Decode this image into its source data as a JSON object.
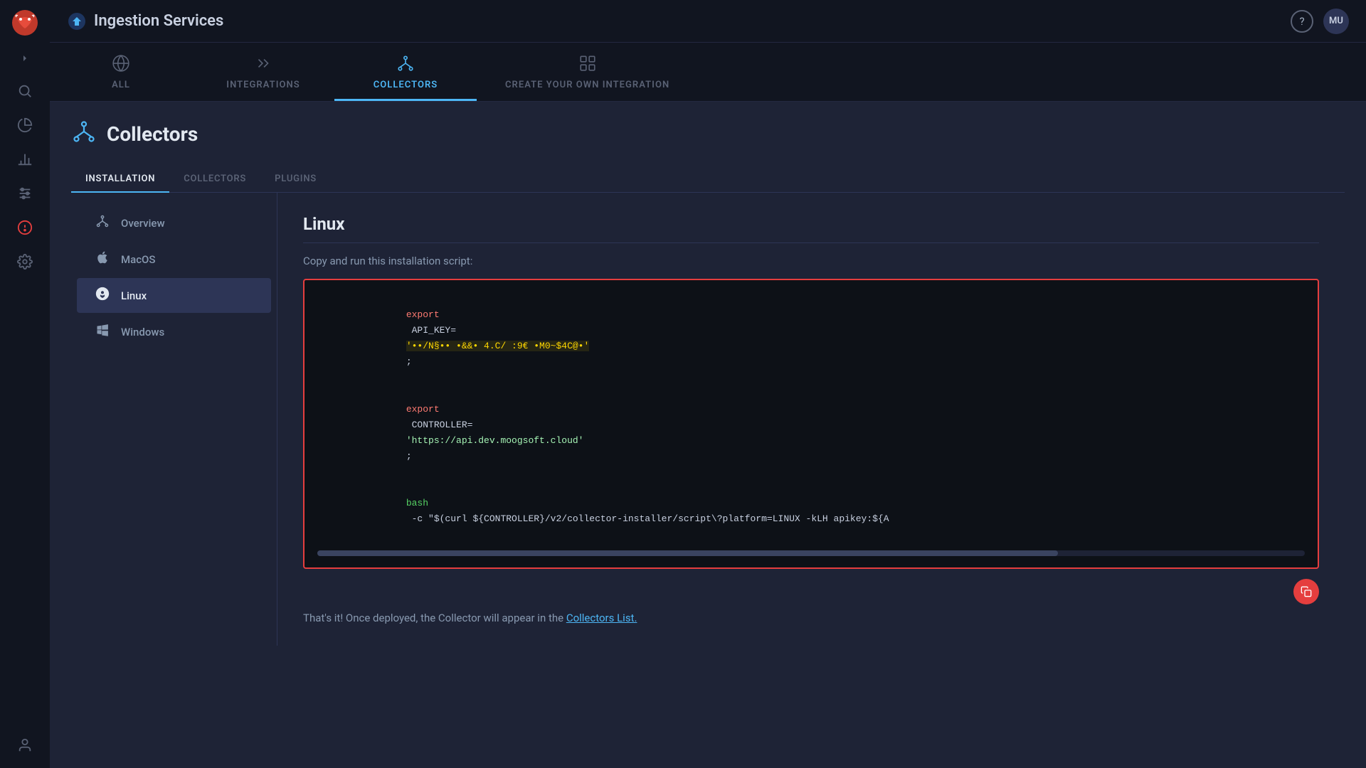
{
  "app": {
    "title": "Ingestion Services",
    "user": "MU"
  },
  "sidebar": {
    "items": [
      {
        "name": "logo",
        "icon": "🐂",
        "label": "Logo"
      },
      {
        "name": "expand",
        "icon": "›",
        "label": "Expand"
      },
      {
        "name": "search",
        "label": "Search"
      },
      {
        "name": "analytics",
        "label": "Analytics"
      },
      {
        "name": "chart",
        "label": "Chart"
      },
      {
        "name": "sliders",
        "label": "Sliders"
      },
      {
        "name": "alert",
        "label": "Alert",
        "active": true
      },
      {
        "name": "settings",
        "label": "Settings"
      },
      {
        "name": "user",
        "label": "User"
      }
    ]
  },
  "tabs": [
    {
      "id": "all",
      "label": "ALL",
      "active": false
    },
    {
      "id": "integrations",
      "label": "INTEGRATIONS",
      "active": false
    },
    {
      "id": "collectors",
      "label": "COLLECTORS",
      "active": true
    },
    {
      "id": "create",
      "label": "CREATE YOUR OWN INTEGRATION",
      "active": false
    }
  ],
  "page": {
    "title": "Collectors",
    "sub_tabs": [
      {
        "label": "INSTALLATION",
        "active": true
      },
      {
        "label": "COLLECTORS",
        "active": false
      },
      {
        "label": "PLUGINS",
        "active": false
      }
    ]
  },
  "left_nav": [
    {
      "label": "Overview",
      "icon": "⊹",
      "active": false
    },
    {
      "label": "MacOS",
      "icon": "🍎",
      "active": false
    },
    {
      "label": "Linux",
      "icon": "🐧",
      "active": true
    },
    {
      "label": "Windows",
      "icon": "⊞",
      "active": false
    }
  ],
  "right_panel": {
    "title": "Linux",
    "description": "Copy and run this installation script:",
    "code": {
      "line1_keyword": "export",
      "line1_var": "API_KEY=",
      "line1_value": "'••/N§•• •&&• 4.C/ :9€ •M0~$4C@•'",
      "line2_keyword": "export",
      "line2_var": "CONTROLLER=",
      "line2_value": "'https://api.dev.moogsoft.cloud'",
      "line3_cmd": "bash",
      "line3_rest": " -c \"$(curl ${CONTROLLER}/v2/collector-installer/script\\?platform=LINUX -kLH apikey:${A"
    },
    "footer": {
      "text": "That's it! Once deployed, the Collector will appear in the ",
      "link_text": "Collectors List.",
      "link_url": "#"
    }
  }
}
